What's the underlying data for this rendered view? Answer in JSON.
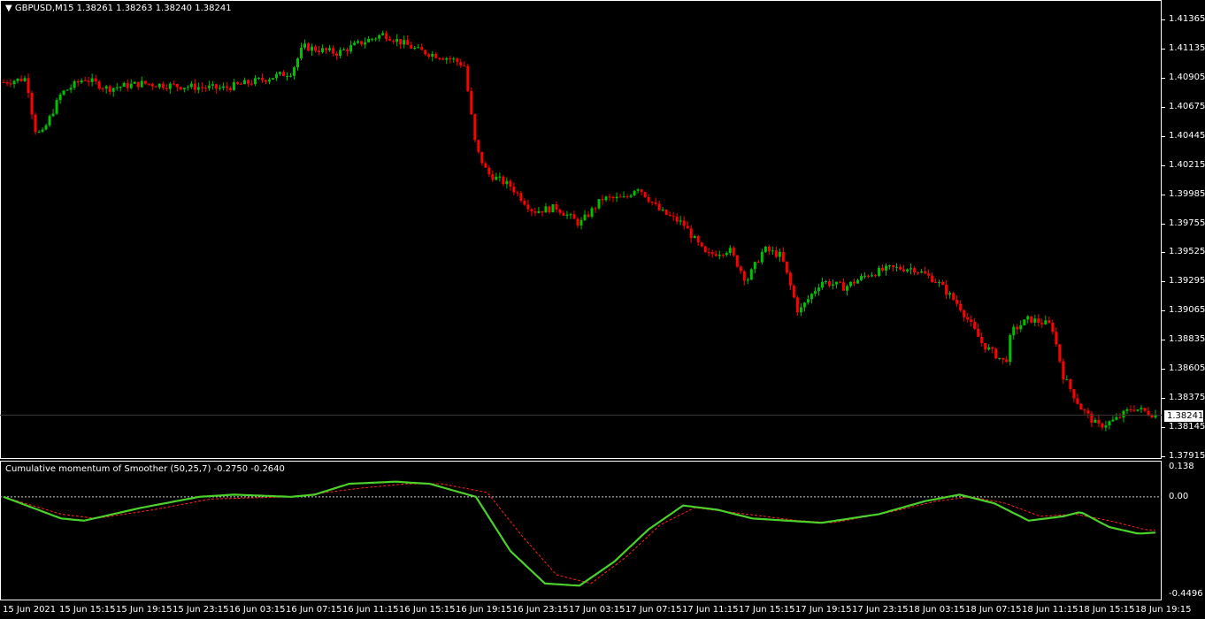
{
  "chart": {
    "symbol": "GBPUSD,M15",
    "ohlc": "1.38261 1.38263 1.38240 1.38241",
    "current_price": "1.38241",
    "up_color": "#00c000",
    "down_color": "#ff0000",
    "price_axis": [
      "1.41365",
      "1.41135",
      "1.40905",
      "1.40675",
      "1.40445",
      "1.40215",
      "1.39985",
      "1.39755",
      "1.39525",
      "1.39295",
      "1.39065",
      "1.38835",
      "1.38605",
      "1.38375",
      "1.38145",
      "1.37915"
    ],
    "price_range": [
      1.37915,
      1.41365
    ]
  },
  "indicator": {
    "title": "Cumulative momentum of Smoother (50,25,7) -0.2750 -0.2640",
    "axis": [
      "0.138",
      "0.00",
      "-0.4496"
    ],
    "range": [
      -0.4496,
      0.138
    ],
    "line_color": "#4cd12a",
    "signal_color": "#ff2020"
  },
  "time_axis": [
    "15 Jun 2021",
    "15 Jun 15:15",
    "15 Jun 19:15",
    "15 Jun 23:15",
    "16 Jun 03:15",
    "16 Jun 07:15",
    "16 Jun 11:15",
    "16 Jun 15:15",
    "16 Jun 19:15",
    "16 Jun 23:15",
    "17 Jun 03:15",
    "17 Jun 07:15",
    "17 Jun 11:15",
    "17 Jun 15:15",
    "17 Jun 19:15",
    "17 Jun 23:15",
    "18 Jun 03:15",
    "18 Jun 07:15",
    "18 Jun 11:15",
    "18 Jun 15:15",
    "18 Jun 19:15"
  ],
  "chart_data": {
    "type": "line",
    "price_path": [
      [
        0,
        1.4087
      ],
      [
        0.02,
        1.409
      ],
      [
        0.027,
        1.405
      ],
      [
        0.033,
        1.4045
      ],
      [
        0.05,
        1.4078
      ],
      [
        0.07,
        1.409
      ],
      [
        0.09,
        1.4082
      ],
      [
        0.12,
        1.4086
      ],
      [
        0.15,
        1.4084
      ],
      [
        0.19,
        1.4082
      ],
      [
        0.22,
        1.4088
      ],
      [
        0.25,
        1.4095
      ],
      [
        0.26,
        1.4115
      ],
      [
        0.29,
        1.411
      ],
      [
        0.31,
        1.4118
      ],
      [
        0.33,
        1.4125
      ],
      [
        0.36,
        1.4112
      ],
      [
        0.39,
        1.4105
      ],
      [
        0.4,
        1.41
      ],
      [
        0.41,
        1.4035
      ],
      [
        0.42,
        1.4015
      ],
      [
        0.44,
        1.4005
      ],
      [
        0.46,
        1.3985
      ],
      [
        0.48,
        1.3988
      ],
      [
        0.5,
        1.3975
      ],
      [
        0.52,
        1.3995
      ],
      [
        0.54,
        1.3995
      ],
      [
        0.55,
        1.4005
      ],
      [
        0.57,
        1.3985
      ],
      [
        0.59,
        1.3975
      ],
      [
        0.61,
        1.395
      ],
      [
        0.63,
        1.3955
      ],
      [
        0.645,
        1.393
      ],
      [
        0.66,
        1.3955
      ],
      [
        0.675,
        1.395
      ],
      [
        0.69,
        1.3905
      ],
      [
        0.71,
        1.393
      ],
      [
        0.73,
        1.3925
      ],
      [
        0.75,
        1.3935
      ],
      [
        0.77,
        1.394
      ],
      [
        0.79,
        1.394
      ],
      [
        0.81,
        1.393
      ],
      [
        0.83,
        1.391
      ],
      [
        0.85,
        1.388
      ],
      [
        0.87,
        1.3865
      ],
      [
        0.875,
        1.389
      ],
      [
        0.89,
        1.39
      ],
      [
        0.91,
        1.3895
      ],
      [
        0.92,
        1.3855
      ],
      [
        0.935,
        1.383
      ],
      [
        0.95,
        1.3815
      ],
      [
        0.965,
        1.382
      ],
      [
        0.98,
        1.383
      ],
      [
        1.0,
        1.38241
      ]
    ],
    "momentum": [
      [
        0,
        0.0
      ],
      [
        0.05,
        -0.1
      ],
      [
        0.07,
        -0.11
      ],
      [
        0.12,
        -0.05
      ],
      [
        0.17,
        0.0
      ],
      [
        0.2,
        0.01
      ],
      [
        0.25,
        0.0
      ],
      [
        0.27,
        0.01
      ],
      [
        0.3,
        0.06
      ],
      [
        0.34,
        0.07
      ],
      [
        0.37,
        0.06
      ],
      [
        0.41,
        0.0
      ],
      [
        0.44,
        -0.25
      ],
      [
        0.47,
        -0.4
      ],
      [
        0.5,
        -0.41
      ],
      [
        0.53,
        -0.3
      ],
      [
        0.56,
        -0.15
      ],
      [
        0.59,
        -0.04
      ],
      [
        0.62,
        -0.06
      ],
      [
        0.65,
        -0.1
      ],
      [
        0.68,
        -0.11
      ],
      [
        0.71,
        -0.12
      ],
      [
        0.76,
        -0.08
      ],
      [
        0.8,
        -0.02
      ],
      [
        0.83,
        0.01
      ],
      [
        0.86,
        -0.03
      ],
      [
        0.89,
        -0.11
      ],
      [
        0.92,
        -0.09
      ],
      [
        0.935,
        -0.07
      ],
      [
        0.96,
        -0.14
      ],
      [
        0.985,
        -0.17
      ],
      [
        1.0,
        -0.165
      ]
    ],
    "signal": [
      [
        0,
        0.0
      ],
      [
        0.05,
        -0.08
      ],
      [
        0.08,
        -0.1
      ],
      [
        0.13,
        -0.06
      ],
      [
        0.18,
        -0.01
      ],
      [
        0.25,
        0.0
      ],
      [
        0.31,
        0.04
      ],
      [
        0.35,
        0.06
      ],
      [
        0.38,
        0.06
      ],
      [
        0.42,
        0.02
      ],
      [
        0.45,
        -0.18
      ],
      [
        0.48,
        -0.36
      ],
      [
        0.51,
        -0.4
      ],
      [
        0.54,
        -0.28
      ],
      [
        0.57,
        -0.13
      ],
      [
        0.6,
        -0.05
      ],
      [
        0.63,
        -0.07
      ],
      [
        0.66,
        -0.09
      ],
      [
        0.69,
        -0.11
      ],
      [
        0.72,
        -0.12
      ],
      [
        0.77,
        -0.07
      ],
      [
        0.81,
        -0.02
      ],
      [
        0.84,
        0.0
      ],
      [
        0.87,
        -0.03
      ],
      [
        0.9,
        -0.09
      ],
      [
        0.93,
        -0.08
      ],
      [
        0.96,
        -0.11
      ],
      [
        0.99,
        -0.15
      ],
      [
        1.0,
        -0.155
      ]
    ]
  }
}
